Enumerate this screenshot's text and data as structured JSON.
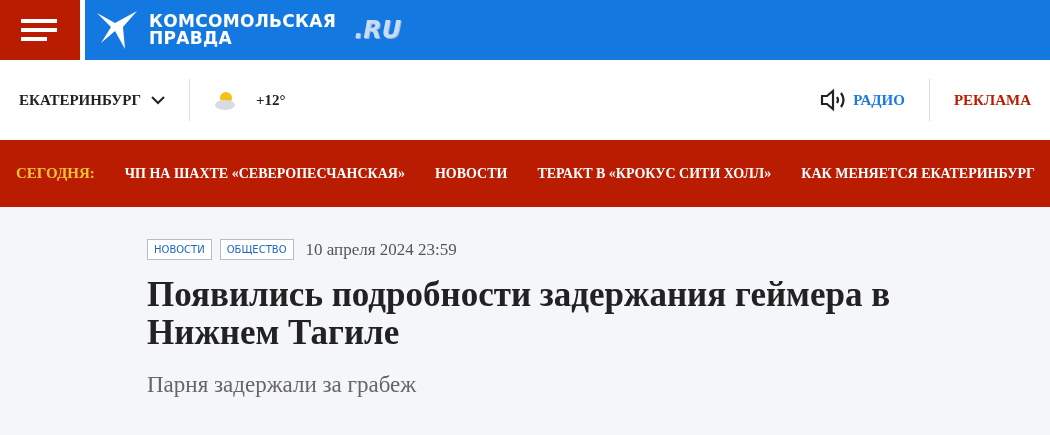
{
  "header": {
    "logo": {
      "line_1": "КОМСОМОЛЬСКАЯ",
      "line_2": "ПРАВДА",
      "domain": ".RU"
    }
  },
  "topbar": {
    "city": "ЕКАТЕРИНБУРГ",
    "temperature": "+12°",
    "radio": "РАДИО",
    "ads": "РЕКЛАМА"
  },
  "today_bar": {
    "label": "СЕГОДНЯ:",
    "links": [
      "ЧП НА ШАХТЕ «СЕВЕРОПЕСЧАНСКАЯ»",
      "НОВОСТИ",
      "ТЕРАКТ В «КРОКУС СИТИ ХОЛЛ»",
      "КАК МЕНЯЕТСЯ ЕКАТЕРИНБУРГ"
    ]
  },
  "article": {
    "tags": [
      "НОВОСТИ",
      "ОБЩЕСТВО"
    ],
    "date": "10 апреля 2024 23:59",
    "title": "Появились подробности задержания геймера в Нижнем Тагиле",
    "subtitle": "Парня задержали за грабеж"
  }
}
